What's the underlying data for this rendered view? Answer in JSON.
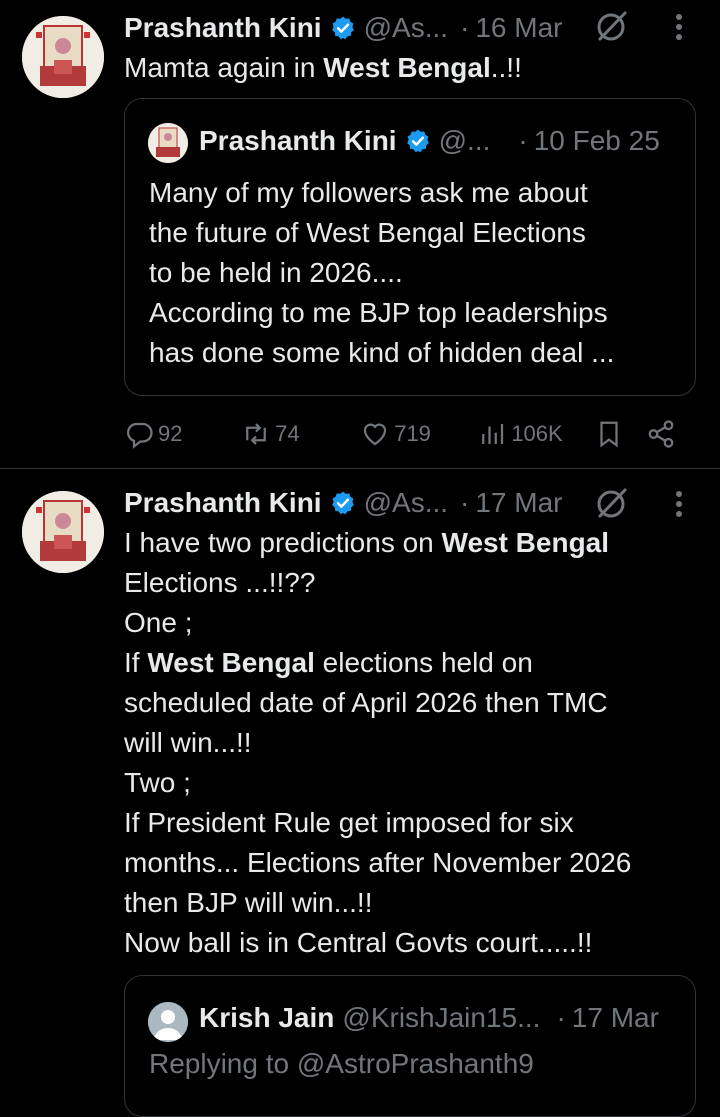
{
  "tweet1": {
    "author_name": "Prashanth Kini",
    "author_handle": "@As...",
    "date": "16 Mar",
    "text_prefix": "Mamta again in ",
    "text_bold": "West Bengal",
    "text_suffix": "..!!",
    "quote": {
      "author_name": "Prashanth Kini",
      "author_handle": "@...",
      "date": "10 Feb 25",
      "text": "Many of my followers ask me about\nthe future of West Bengal Elections\nto be held in 2026....\nAccording to me BJP top leaderships\nhas done some kind of hidden deal ..."
    },
    "actions": {
      "replies": "92",
      "reposts": "74",
      "likes": "719",
      "views": "106K"
    }
  },
  "tweet2": {
    "author_name": "Prashanth Kini",
    "author_handle": "@As...",
    "date": "17 Mar",
    "line1_prefix": "I have two predictions on ",
    "line1_bold": "West Bengal",
    "line2": "Elections ...!!??",
    "line3": "One ;",
    "line4_prefix": "If ",
    "line4_bold": "West Bengal",
    "line4_suffix": " elections held on",
    "line5": "scheduled date of April 2026 then TMC",
    "line6": "will win...!!",
    "line7": "Two ;",
    "line8": "If President Rule get imposed for six",
    "line9": "months... Elections after November 2026",
    "line10": "then BJP will win...!!",
    "line11": "Now ball is in Central Govts court.....!!",
    "quote": {
      "author_name": "Krish Jain",
      "author_handle": "@KrishJain15...",
      "date": "17 Mar",
      "replying_to": "Replying to @AstroPrashanth9"
    }
  },
  "colors": {
    "background": "#000000",
    "text": "#e7e9ea",
    "muted": "#71767b",
    "verified": "#1d9bf0",
    "border": "#2f3336"
  },
  "icons": [
    "verified-badge-icon",
    "grok-icon",
    "more-icon",
    "reply-icon",
    "repost-icon",
    "like-icon",
    "views-icon",
    "bookmark-icon",
    "share-icon"
  ]
}
